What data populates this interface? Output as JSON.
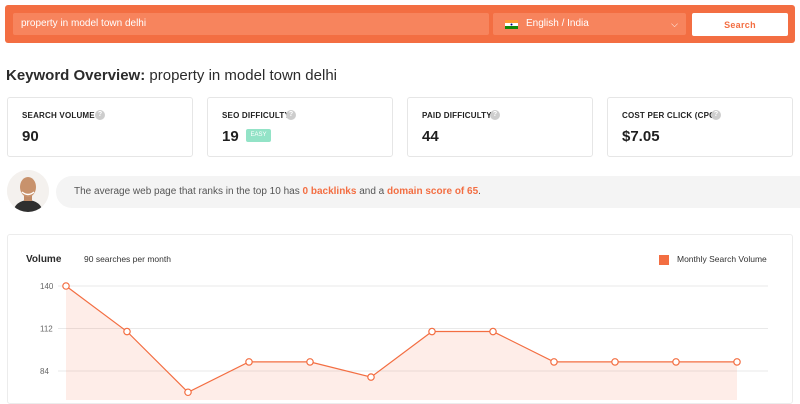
{
  "search": {
    "query": "property in model town delhi",
    "language": "English / India",
    "button_label": "Search"
  },
  "overview": {
    "title_label": "Keyword Overview:",
    "keyword": "property in model town delhi"
  },
  "metrics": [
    {
      "label": "SEARCH VOLUME",
      "value": "90"
    },
    {
      "label": "SEO DIFFICULTY",
      "value": "19",
      "badge": "EASY"
    },
    {
      "label": "PAID DIFFICULTY",
      "value": "44"
    },
    {
      "label": "COST PER CLICK (CPC)",
      "value": "$7.05"
    }
  ],
  "insight": {
    "prefix": "The average web page that ranks in the top 10 has ",
    "backlinks": "0 backlinks",
    "middle": " and a ",
    "domain_score": "domain score of 65",
    "suffix": "."
  },
  "chart": {
    "title": "Volume",
    "subtitle": "90 searches per month",
    "legend": "Monthly Search Volume"
  },
  "chart_data": {
    "type": "area",
    "series": [
      {
        "name": "Monthly Search Volume",
        "values": [
          140,
          110,
          70,
          90,
          90,
          80,
          110,
          110,
          90,
          90,
          90,
          90
        ]
      }
    ],
    "y_ticks": [
      140,
      112,
      84
    ],
    "color": "#f36e42",
    "grid": true,
    "legend_position": "top-right"
  },
  "colors": {
    "brand": "#f36e42",
    "easy": "#93e3c7"
  }
}
